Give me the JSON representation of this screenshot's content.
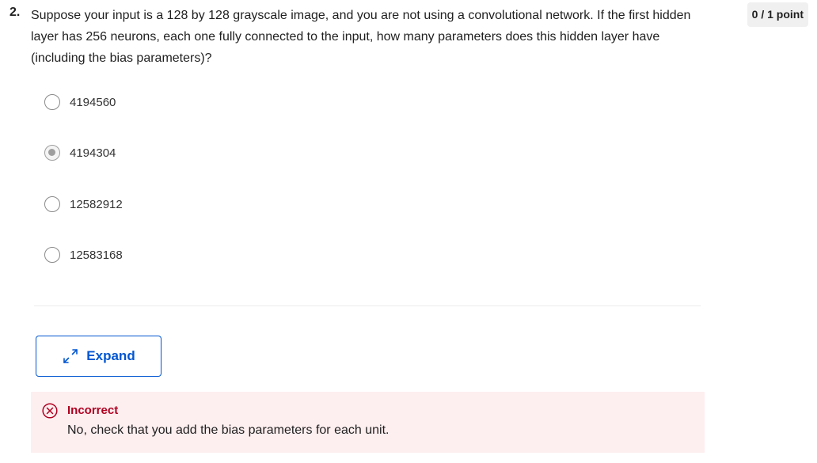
{
  "question": {
    "number": "2.",
    "text": "Suppose your input is a 128 by 128 grayscale image, and you are not using a convolutional network. If the first hidden layer has 256 neurons, each one fully connected to the input, how many parameters does this hidden layer have (including the bias parameters)?",
    "points": "0 / 1 point"
  },
  "options": [
    {
      "label": "4194560",
      "selected": false
    },
    {
      "label": "4194304",
      "selected": true
    },
    {
      "label": "12582912",
      "selected": false
    },
    {
      "label": "12583168",
      "selected": false
    }
  ],
  "expand": {
    "label": "Expand",
    "icon": "expand-arrows-icon"
  },
  "feedback": {
    "status": "Incorrect",
    "message": "No, check that you add the bias parameters for each unit.",
    "icon": "x-circle-icon",
    "color": "#b00020",
    "background": "#fdeeef"
  },
  "colors": {
    "accent": "#0056d2",
    "error": "#b00020"
  }
}
